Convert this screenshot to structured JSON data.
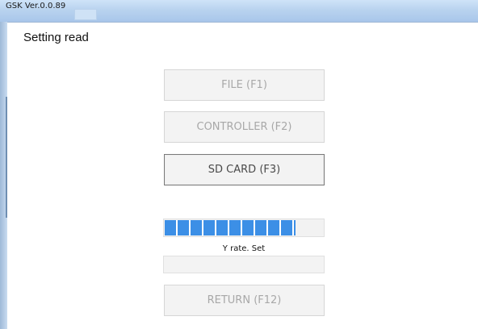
{
  "window": {
    "title": "GSK Ver.0.0.89"
  },
  "page": {
    "title": "Setting read"
  },
  "buttons": {
    "file": "FILE (F1)",
    "controller": "CONTROLLER (F2)",
    "sd_card": "SD CARD (F3)",
    "return": "RETURN (F12)"
  },
  "progress": {
    "fraction": 0.82,
    "label": "Y rate. Set"
  },
  "status": {
    "text": ""
  },
  "colors": {
    "progress_fill": "#3c8fe6",
    "titlebar": "#b9d3ef"
  }
}
